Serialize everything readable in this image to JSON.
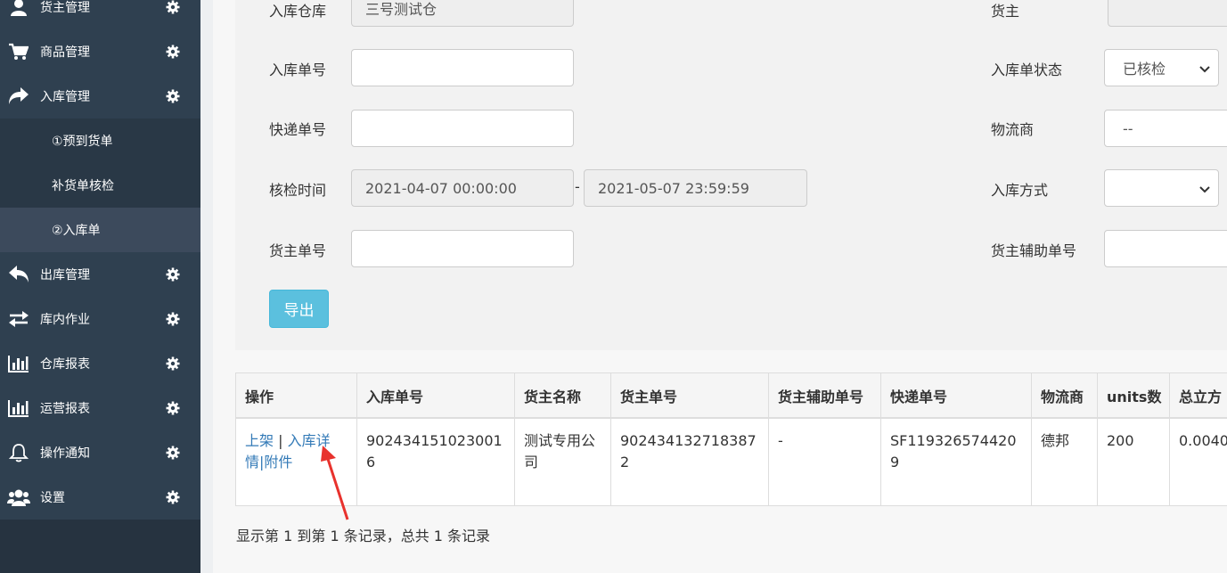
{
  "sidebar": {
    "items": [
      {
        "label": "货主管理",
        "icon": "user-icon"
      },
      {
        "label": "商品管理",
        "icon": "cart-icon"
      },
      {
        "label": "入库管理",
        "icon": "share-arrow-icon"
      },
      {
        "label": "出库管理",
        "icon": "reply-arrow-icon"
      },
      {
        "label": "库内作业",
        "icon": "exchange-icon"
      },
      {
        "label": "仓库报表",
        "icon": "bar-chart-icon"
      },
      {
        "label": "运营报表",
        "icon": "bar-chart-icon"
      },
      {
        "label": "操作通知",
        "icon": "bell-icon"
      },
      {
        "label": "设置",
        "icon": "users-icon"
      }
    ],
    "sub_items": [
      {
        "label": "①预到货单"
      },
      {
        "label": "补货单核检"
      },
      {
        "label": "②入库单"
      }
    ],
    "colors": {
      "bg": "#2f4050",
      "sub_bg": "#293846",
      "active_bg": "#3c4a5c"
    }
  },
  "form": {
    "warehouse_label": "入库仓库",
    "warehouse_value": "三号测试仓",
    "owner_label": "货主",
    "owner_value": "",
    "order_no_label": "入库单号",
    "order_no_value": "",
    "status_label": "入库单状态",
    "status_value": "已核检",
    "express_no_label": "快递单号",
    "express_no_value": "",
    "logistics_label": "物流商",
    "logistics_value": "--",
    "check_time_label": "核检时间",
    "check_time_start": "2021-04-07 00:00:00",
    "check_time_sep": "-",
    "check_time_end": "2021-05-07 23:59:59",
    "inbound_method_label": "入库方式",
    "inbound_method_value": "",
    "owner_order_label": "货主单号",
    "owner_order_value": "",
    "owner_aux_label": "货主辅助单号",
    "owner_aux_value": "",
    "export_label": "导出"
  },
  "table": {
    "columns": [
      "操作",
      "入库单号",
      "货主名称",
      "货主单号",
      "货主辅助单号",
      "快递单号",
      "物流商",
      "units数",
      "总立方"
    ],
    "rows": [
      {
        "action_shelve": "上架",
        "action_sep1": " | ",
        "action_detail": "入库详情",
        "action_sep2": "|",
        "action_attach": "附件",
        "order_no": "9024341510230016",
        "owner_name": "测试专用公司",
        "owner_order": "9024341327183872",
        "owner_aux": "-",
        "express_no": "SF1193265744209",
        "logistics": "德邦",
        "units": "200",
        "volume": "0.0040"
      }
    ]
  },
  "pagination": {
    "info": "显示第 1 到第 1 条记录，总共 1 条记录"
  },
  "colors": {
    "accent": "#5bc0de",
    "link": "#337ab7",
    "annotation": "#e8322d"
  }
}
